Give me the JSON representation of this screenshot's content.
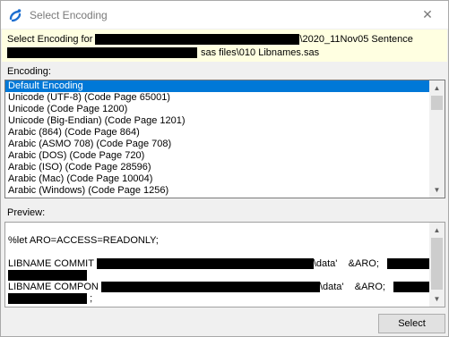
{
  "window": {
    "title": "Select Encoding",
    "close_glyph": "✕"
  },
  "banner": {
    "prefix": "Select Encoding for",
    "path_tail": "\\2020_11Nov05 Sentence",
    "line2": "sas files\\010 Libnames.sas"
  },
  "encoding_label": "Encoding:",
  "encodings": [
    "Default Encoding",
    "Unicode (UTF-8) (Code Page 65001)",
    "Unicode (Code Page 1200)",
    "Unicode (Big-Endian) (Code Page 1201)",
    "Arabic (864) (Code Page 864)",
    "Arabic (ASMO 708) (Code Page 708)",
    "Arabic (DOS) (Code Page 720)",
    "Arabic (ISO) (Code Page 28596)",
    "Arabic (Mac) (Code Page 10004)",
    "Arabic (Windows) (Code Page 1256)"
  ],
  "selected_encoding": "Default Encoding",
  "preview_label": "Preview:",
  "preview": {
    "let_line": "%let ARO=ACCESS=READONLY;",
    "libname1_prefix": "LIBNAME COMMIT",
    "libname1_mid": "\\data'",
    "libname1_opt": "&ARO;",
    "libname2_prefix": "LIBNAME COMPON",
    "libname2_mid": "\\data'",
    "libname2_opt": "&ARO;",
    "semicolon": ";"
  },
  "buttons": {
    "select": "Select"
  },
  "icons": {
    "app": "sas-app-icon",
    "close": "close-icon",
    "up": "scroll-up-icon",
    "down": "scroll-down-icon"
  }
}
